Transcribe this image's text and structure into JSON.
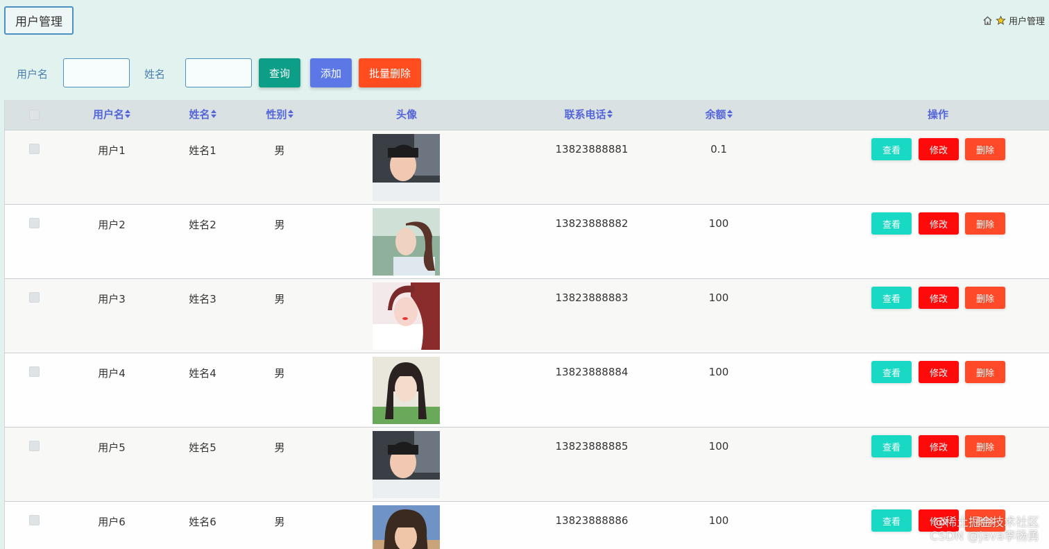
{
  "title_tab": "用户管理",
  "breadcrumb": {
    "label": "用户管理"
  },
  "search": {
    "username_label": "用户名",
    "name_label": "姓名",
    "username_value": "",
    "name_value": "",
    "query_button": "查询",
    "add_button": "添加",
    "batch_delete_button": "批量删除"
  },
  "table": {
    "headers": {
      "username": "用户名",
      "name": "姓名",
      "gender": "性别",
      "avatar": "头像",
      "phone": "联系电话",
      "balance": "余额",
      "actions": "操作"
    },
    "rows": [
      {
        "username": "用户1",
        "name": "姓名1",
        "gender": "男",
        "phone": "13823888881",
        "balance": "0.1"
      },
      {
        "username": "用户2",
        "name": "姓名2",
        "gender": "男",
        "phone": "13823888882",
        "balance": "100"
      },
      {
        "username": "用户3",
        "name": "姓名3",
        "gender": "男",
        "phone": "13823888883",
        "balance": "100"
      },
      {
        "username": "用户4",
        "name": "姓名4",
        "gender": "男",
        "phone": "13823888884",
        "balance": "100"
      },
      {
        "username": "用户5",
        "name": "姓名5",
        "gender": "男",
        "phone": "13823888885",
        "balance": "100"
      },
      {
        "username": "用户6",
        "name": "姓名6",
        "gender": "男",
        "phone": "13823888886",
        "balance": "100"
      }
    ],
    "actions": {
      "view": "查看",
      "edit": "修改",
      "delete": "删除"
    }
  },
  "watermark": {
    "line1": "@稀土掘金技术社区",
    "line2": "CSDN @java李杨勇"
  },
  "colors": {
    "background": "#e2f2ee",
    "query": "#0d9e88",
    "add": "#5b78e6",
    "batch_delete": "#ff4d1f",
    "view": "#17d9c4",
    "edit": "#ff0a0a",
    "delete": "#ff4a2a",
    "header_text": "#5566d8"
  }
}
